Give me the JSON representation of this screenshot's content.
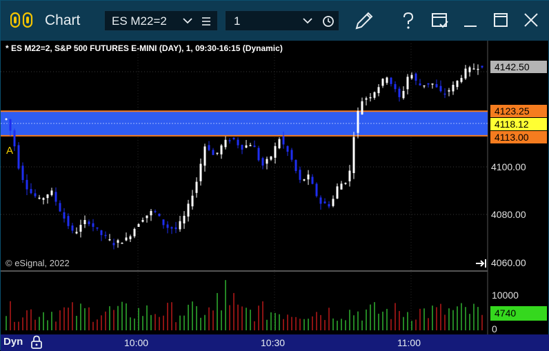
{
  "window": {
    "title": "Chart"
  },
  "toolbar": {
    "symbol": "ES M22=2",
    "interval": "1"
  },
  "chart": {
    "study_label": "* ES M22=2, S&P 500 FUTURES E-MINI (DAY), 1, 09:30-16:15 (Dynamic)",
    "copyright": "© eSignal, 2022",
    "marker": "A",
    "price_axis": [
      "4142.50",
      "4100.00",
      "4080.00",
      "4060.00"
    ],
    "price_tags": [
      {
        "value": "4123.25",
        "color": "#f57c1f",
        "text_color": "#000000"
      },
      {
        "value": "4118.12",
        "color": "#ffff33",
        "text_color": "#000000"
      },
      {
        "value": "4113.00",
        "color": "#f57c1f",
        "text_color": "#000000"
      }
    ],
    "last_price_tag": {
      "value": "4142.50",
      "color": "#b4b4b4"
    },
    "volume_axis": [
      "10000",
      "0"
    ],
    "volume_tag": {
      "value": "4740",
      "color": "#35d81e"
    },
    "time_axis": [
      "10:00",
      "10:30",
      "11:00"
    ],
    "mode": "Dyn",
    "colors": {
      "up": "#ffffff",
      "down": "#1e2ef0",
      "band": "#2f5df2",
      "band_border": "#f57c1f",
      "vol_up": "#2ea82e",
      "vol_down": "#b01818"
    }
  }
}
